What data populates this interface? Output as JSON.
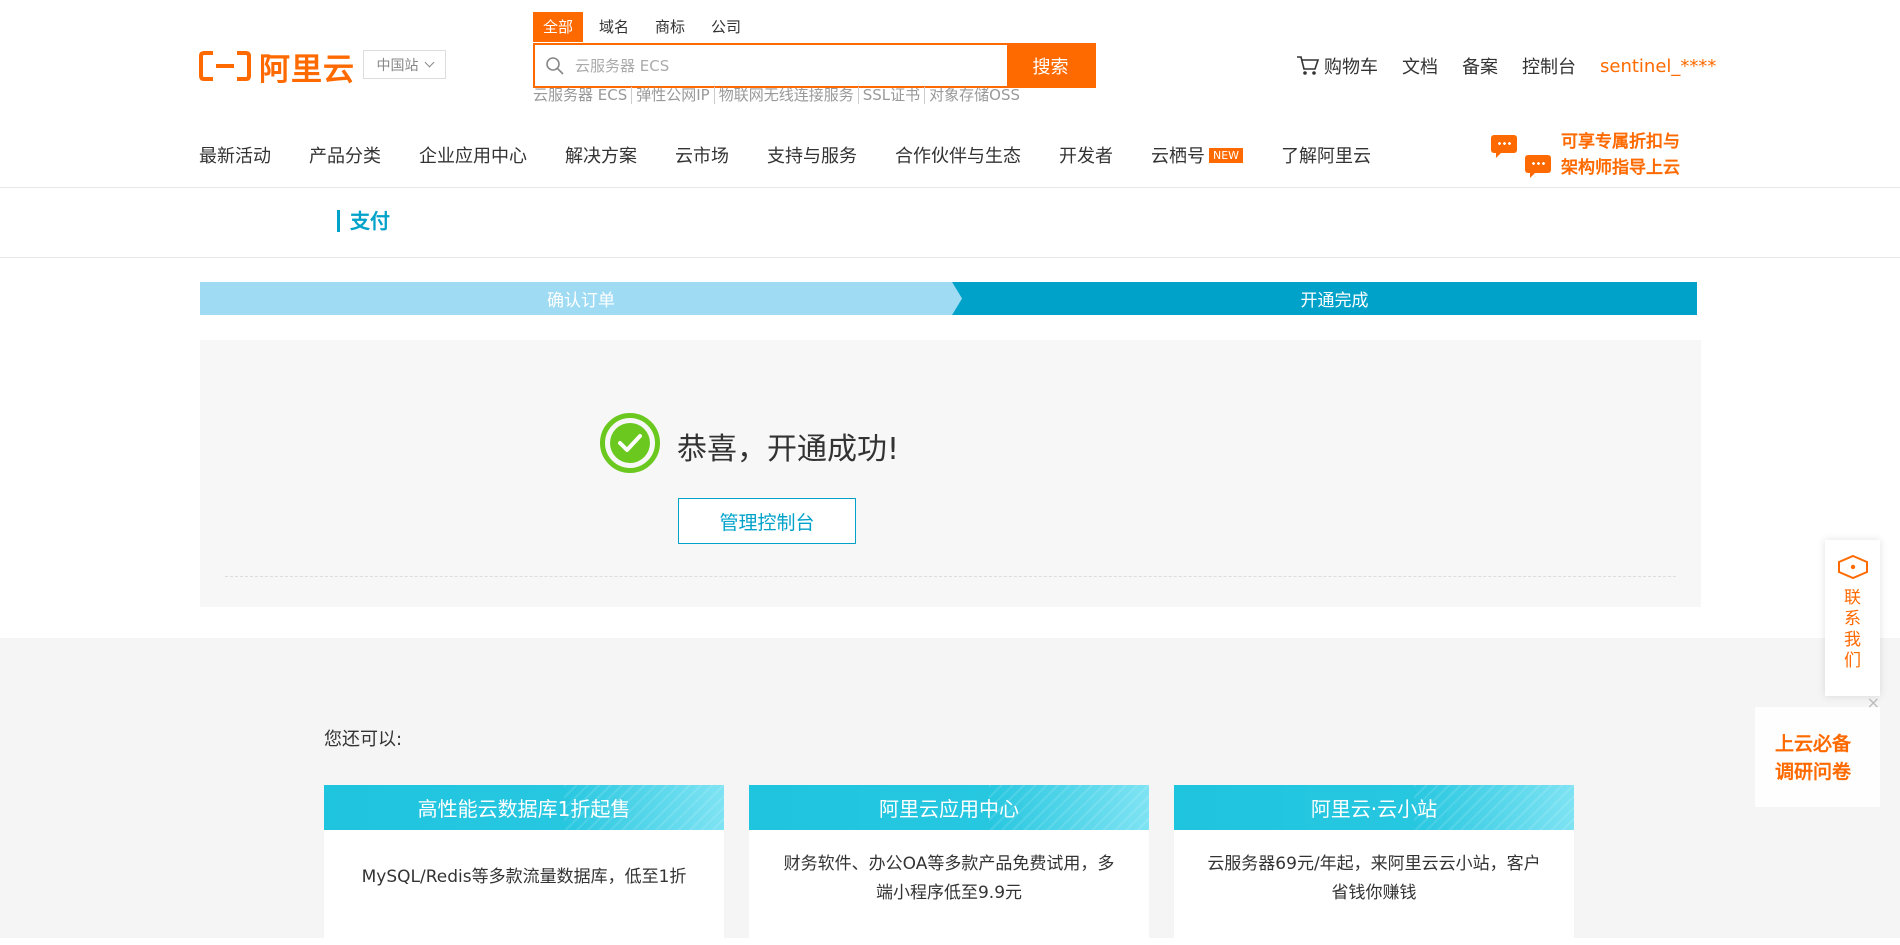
{
  "header": {
    "logo_text": "阿里云",
    "region": "中国站",
    "search_tabs": [
      "全部",
      "域名",
      "商标",
      "公司"
    ],
    "search_placeholder": "云服务器 ECS",
    "search_button": "搜索",
    "hot_links": [
      "云服务器 ECS",
      "弹性公网IP",
      "物联网无线连接服务",
      "SSL证书",
      "对象存储OSS"
    ],
    "top_links": {
      "cart": "购物车",
      "docs": "文档",
      "record": "备案",
      "console": "控制台",
      "user": "sentinel_****"
    },
    "nav": [
      "最新活动",
      "产品分类",
      "企业应用中心",
      "解决方案",
      "云市场",
      "支持与服务",
      "合作伙伴与生态",
      "开发者",
      "云栖号",
      "了解阿里云"
    ],
    "nav_badge": "NEW",
    "promo_line1": "可享专属折扣与",
    "promo_line2": "架构师指导上云"
  },
  "page_title": "支付",
  "steps": {
    "done": "确认订单",
    "active": "开通完成"
  },
  "success": {
    "message": "恭喜，开通成功!",
    "button": "管理控制台"
  },
  "more": {
    "label": "您还可以:",
    "cards": [
      {
        "title": "高性能云数据库1折起售",
        "desc": "MySQL/Redis等多款流量数据库，低至1折"
      },
      {
        "title": "阿里云应用中心",
        "desc": "财务软件、办公OA等多款产品免费试用，多端小程序低至9.9元"
      },
      {
        "title": "阿里云·云小站",
        "desc": "云服务器69元/年起，来阿里云云小站，客户省钱你赚钱"
      }
    ]
  },
  "widgets": {
    "contact": "联系我们",
    "survey_line1": "上云必备",
    "survey_line2": "调研问卷",
    "survey_close": "×"
  },
  "colors": {
    "brand": "#ff6a00",
    "accent": "#00a2ca",
    "step_done": "#9fdcf3",
    "success": "#6bc81e"
  }
}
